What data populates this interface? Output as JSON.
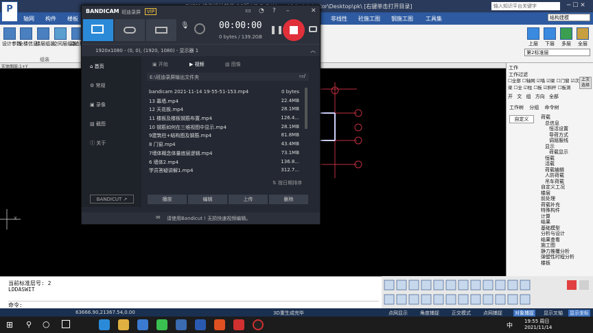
{
  "app": {
    "title": "PKPM 结构设计软件 10版 V5.2 C:\\Users\\Administrator\\Desktop\\pk\\ [右键单击打开目录]",
    "search_placeholder": "输入知识平台关键字",
    "tab_label": "PK"
  },
  "menu": [
    "轴网",
    "构件",
    "楼板",
    "",
    "非线性",
    "砼施工图",
    "钢施工图",
    "工具集"
  ],
  "ribbon": {
    "left_buttons": [
      "设计参数",
      "全楼信息",
      "楼层组装",
      "空间层组装",
      "动态模型"
    ],
    "group_label": "组装",
    "right_buttons": [
      "上层",
      "下层",
      "多层",
      "全层"
    ],
    "layer_select": "第2标准层",
    "model_select": "结构建模"
  },
  "canvas": {
    "axis_x_label": "X",
    "axis_corner_label": "实体图层:1+Y",
    "grid_marks": [
      "1",
      "2",
      "3",
      "4"
    ]
  },
  "right_panel": {
    "title": "工作",
    "filter_title": "工作过滤",
    "filters": [
      "全部",
      "轴网",
      "墙",
      "梁",
      "门窗",
      "次梁",
      "全",
      "柱",
      "板",
      "斜杆",
      "板洞"
    ],
    "filter_button": "上次选择",
    "view_tabs": [
      "开",
      "文",
      "组",
      "方向",
      "全部"
    ],
    "tabs": [
      "工作树",
      "分组",
      "命令树"
    ],
    "custom_button": "自定义",
    "tree": [
      "荷载",
      "总信息",
      "恒活设置",
      "导荷方式",
      "调屈服线",
      "显示",
      "荷载显示",
      "恒载",
      "活载",
      "荷载编辑",
      "人防荷载",
      "吊车荷载",
      "自定义工况",
      "楼层",
      "前处理",
      "荷载补充",
      "特殊构件",
      "计算",
      "结果",
      "基础模型",
      "分析与设计",
      "结果查看",
      "施工图",
      "静力推覆分析",
      "弹塑性时程分析",
      "楼板"
    ]
  },
  "command": {
    "lines": [
      "当前标准层号: 2",
      "LDDASWIT",
      "命令:"
    ]
  },
  "status": {
    "coords": "63666.90,21367.54,0.00",
    "mode": "3D重生成完毕",
    "toggles": [
      "点网显示",
      "角度捕捉",
      "正交模式",
      "点网捕捉",
      "对象捕捉",
      "显示叉轴",
      "显示坐标"
    ]
  },
  "taskbar": {
    "time": "19:55 周日",
    "date": "2021/11/14",
    "lang": "中"
  },
  "bandicam": {
    "brand": "BANDICAM",
    "brand_cn": "班迪录屏",
    "vip": "VIP",
    "timer": "00:00:00",
    "size": "0 bytes / 139.2GB",
    "capture_info": "1920x1080 - (0, 0), (1920, 1080) - 显示器 1",
    "sidebar": [
      "首页",
      "常规",
      "录像",
      "截图",
      "关于"
    ],
    "sidebar_logo": "BANDICUT ↗",
    "content_tabs": [
      "开始",
      "视频",
      "图像"
    ],
    "path": "E:\\班迪录屏输出文件夹",
    "files": [
      {
        "name": "bandicam 2021-11-14 19-55-51-153.mp4",
        "size": "0 bytes"
      },
      {
        "name": "13 幕墙.mp4",
        "size": "22.4MB"
      },
      {
        "name": "12 天花板.mp4",
        "size": "28.1MB"
      },
      {
        "name": "11 楼板及楼板钢筋布置.mp4",
        "size": "126.4..."
      },
      {
        "name": "10 钢筋如何在三维视图中显示.mp4",
        "size": "28.1MB"
      },
      {
        "name": "9建筑柱+结构图及钢筋.mp4",
        "size": "81.8MB"
      },
      {
        "name": "8 门窗.mp4",
        "size": "43.4MB"
      },
      {
        "name": "7墙体概念体量底层逻辑.mp4",
        "size": "73.1MB"
      },
      {
        "name": "6 墙体2.mp4",
        "size": "136.8..."
      },
      {
        "name": "学员答疑讲解1.mp4",
        "size": "312.7..."
      }
    ],
    "sort_label": "按日期排序",
    "actions": [
      "播放",
      "编辑",
      "上传",
      "删除"
    ],
    "footer": "请使用Bandicut ! 无损快速视频编辑。",
    "colors": {
      "accent": "#2b8ad8",
      "record": "#e0303a"
    }
  }
}
